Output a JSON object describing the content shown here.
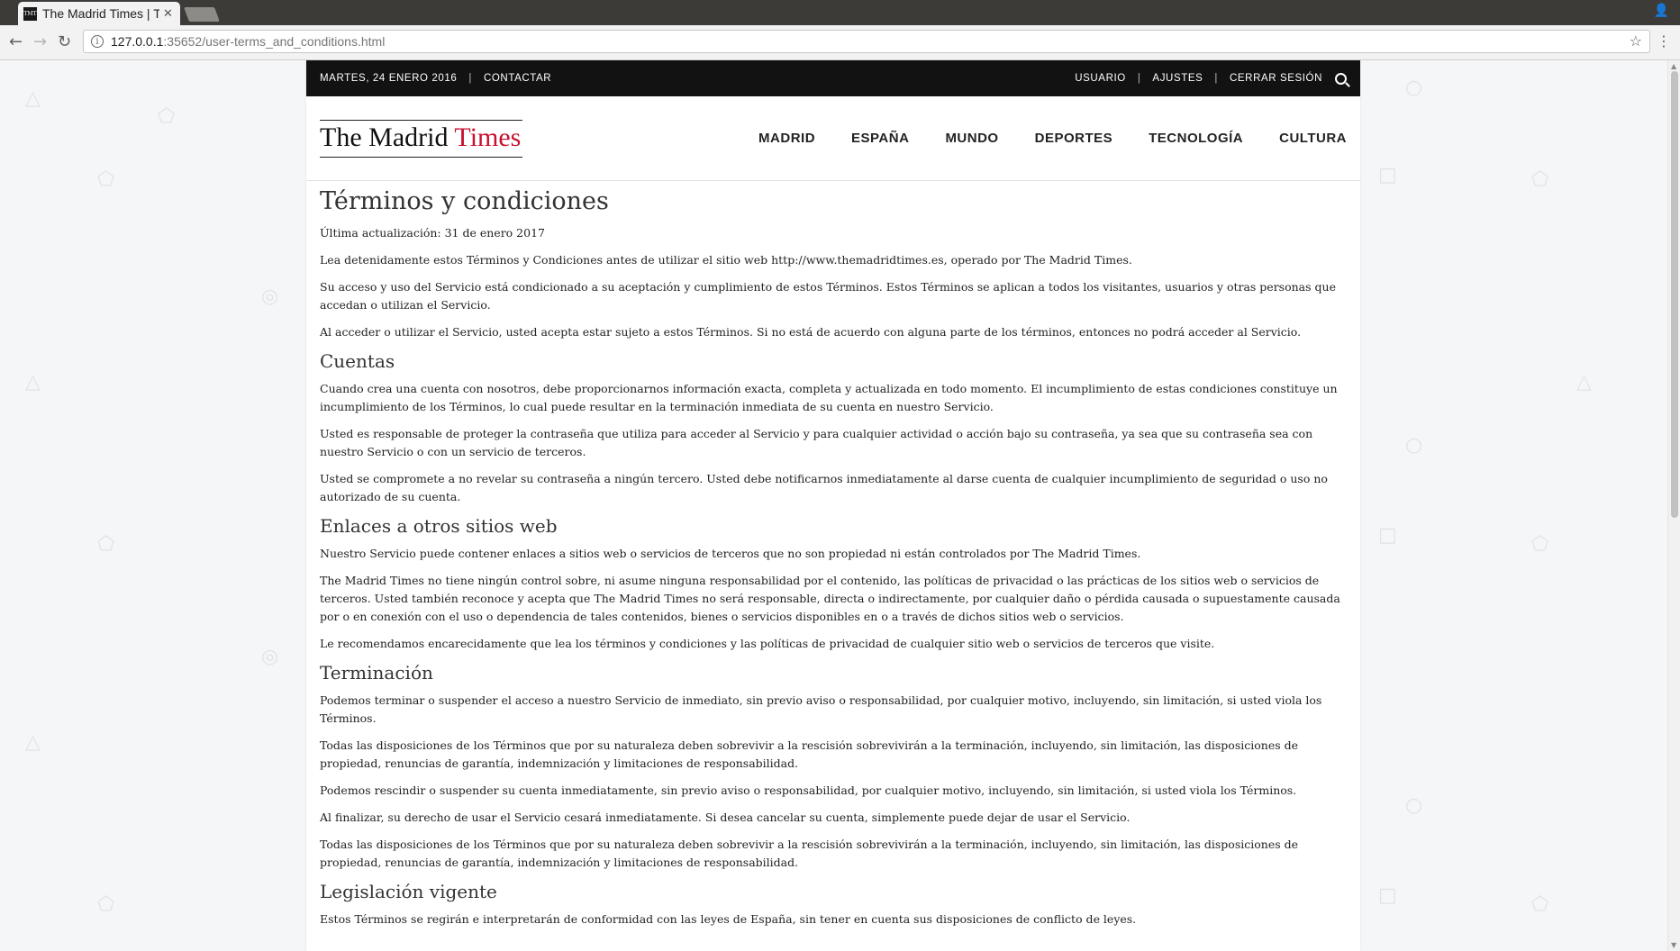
{
  "browser": {
    "tab_title": "The Madrid Times | Términos y condiciones",
    "favicon_text": "TMT",
    "url_host": "127.0.0.1",
    "url_path": ":35652/user-terms_and_conditions.html"
  },
  "topbar": {
    "date": "MARTES, 24 ENERO 2016",
    "contact": "CONTACTAR",
    "user": "USUARIO",
    "settings": "AJUSTES",
    "logout": "CERRAR SESIÓN"
  },
  "header": {
    "logo_black": "The Madrid ",
    "logo_red": "Times",
    "nav": [
      "MADRID",
      "ESPAÑA",
      "MUNDO",
      "DEPORTES",
      "TECNOLOGÍA",
      "CULTURA"
    ]
  },
  "colors": {
    "brand_red": "#c8102e",
    "topbar_bg": "#121212"
  },
  "article": {
    "title": "Términos y condiciones",
    "intro": [
      "Última actualización: 31 de enero 2017",
      "Lea detenidamente estos Términos y Condiciones antes de utilizar el sitio web http://www.themadridtimes.es, operado por The Madrid Times.",
      "Su acceso y uso del Servicio está condicionado a su aceptación y cumplimiento de estos Términos. Estos Términos se aplican a todos los visitantes, usuarios y otras personas que accedan o utilizan el Servicio.",
      "Al acceder o utilizar el Servicio, usted acepta estar sujeto a estos Términos. Si no está de acuerdo con alguna parte de los términos, entonces no podrá acceder al Servicio."
    ],
    "sections": [
      {
        "heading": "Cuentas",
        "paragraphs": [
          "Cuando crea una cuenta con nosotros, debe proporcionarnos información exacta, completa y actualizada en todo momento. El incumplimiento de estas condiciones constituye un incumplimiento de los Términos, lo cual puede resultar en la terminación inmediata de su cuenta en nuestro Servicio.",
          "Usted es responsable de proteger la contraseña que utiliza para acceder al Servicio y para cualquier actividad o acción bajo su contraseña, ya sea que su contraseña sea con nuestro Servicio o con un servicio de terceros.",
          "Usted se compromete a no revelar su contraseña a ningún tercero. Usted debe notificarnos inmediatamente al darse cuenta de cualquier incumplimiento de seguridad o uso no autorizado de su cuenta."
        ]
      },
      {
        "heading": "Enlaces a otros sitios web",
        "paragraphs": [
          "Nuestro Servicio puede contener enlaces a sitios web o servicios de terceros que no son propiedad ni están controlados por The Madrid Times.",
          "The Madrid Times no tiene ningún control sobre, ni asume ninguna responsabilidad por el contenido, las políticas de privacidad o las prácticas de los sitios web o servicios de terceros. Usted también reconoce y acepta que The Madrid Times no será responsable, directa o indirectamente, por cualquier daño o pérdida causada o supuestamente causada por o en conexión con el uso o dependencia de tales contenidos, bienes o servicios disponibles en o a través de dichos sitios web o servicios.",
          "Le recomendamos encarecidamente que lea los términos y condiciones y las políticas de privacidad de cualquier sitio web o servicios de terceros que visite."
        ]
      },
      {
        "heading": "Terminación",
        "paragraphs": [
          "Podemos terminar o suspender el acceso a nuestro Servicio de inmediato, sin previo aviso o responsabilidad, por cualquier motivo, incluyendo, sin limitación, si usted viola los Términos.",
          "Todas las disposiciones de los Términos que por su naturaleza deben sobrevivir a la rescisión sobrevivirán a la terminación, incluyendo, sin limitación, las disposiciones de propiedad, renuncias de garantía, indemnización y limitaciones de responsabilidad.",
          "Podemos rescindir o suspender su cuenta inmediatamente, sin previo aviso o responsabilidad, por cualquier motivo, incluyendo, sin limitación, si usted viola los Términos.",
          "Al finalizar, su derecho de usar el Servicio cesará inmediatamente. Si desea cancelar su cuenta, simplemente puede dejar de usar el Servicio.",
          "Todas las disposiciones de los Términos que por su naturaleza deben sobrevivir a la rescisión sobrevivirán a la terminación, incluyendo, sin limitación, las disposiciones de propiedad, renuncias de garantía, indemnización y limitaciones de responsabilidad."
        ]
      },
      {
        "heading": "Legislación vigente",
        "paragraphs": [
          "Estos Términos se regirán e interpretarán de conformidad con las leyes de España, sin tener en cuenta sus disposiciones de conflicto de leyes."
        ]
      }
    ]
  }
}
